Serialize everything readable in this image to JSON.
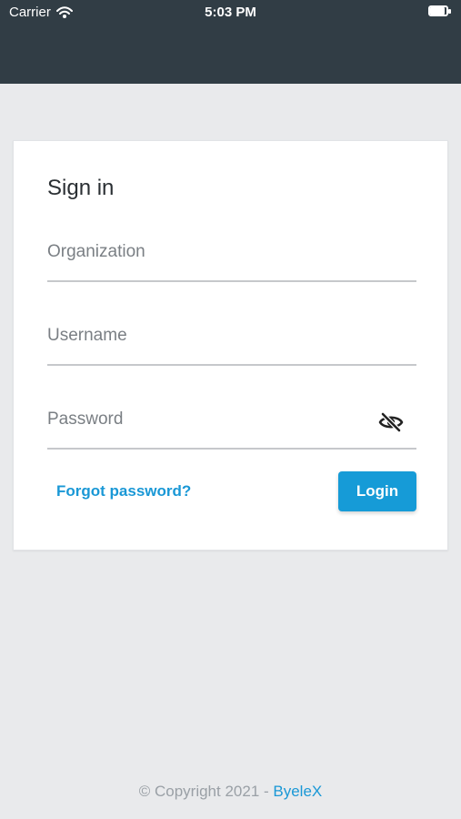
{
  "status_bar": {
    "carrier": "Carrier",
    "time": "5:03 PM",
    "icons": {
      "wifi": "wifi-icon",
      "battery": "battery-icon"
    }
  },
  "card": {
    "title": "Sign in",
    "fields": {
      "organization": {
        "label": "Organization",
        "value": ""
      },
      "username": {
        "label": "Username",
        "value": ""
      },
      "password": {
        "label": "Password",
        "value": "",
        "toggle_icon": "eye-off-icon"
      }
    },
    "actions": {
      "forgot_password": "Forgot password?",
      "login": "Login"
    }
  },
  "footer": {
    "copyright": "© Copyright 2021 - ",
    "brand": "ByeleX"
  },
  "colors": {
    "header_bg": "#313d45",
    "page_bg": "#e9eaec",
    "accent": "#169bd7",
    "link": "#1a98d6",
    "text_muted": "#7a7f84"
  }
}
